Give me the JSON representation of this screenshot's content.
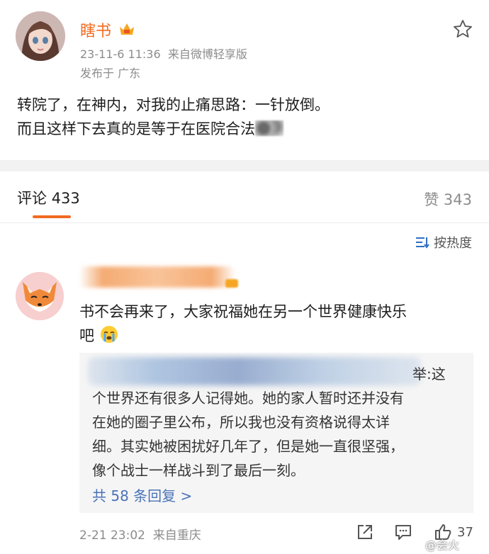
{
  "post": {
    "author": "瞎书",
    "timestamp": "23-11-6 11:36",
    "source": "来自微博轻享版",
    "location": "发布于 广东",
    "text_line1": "转院了，在神内，对我的止痛思路：一针放倒。",
    "text_line2": "而且这样下去真的是等于在医院合法",
    "icons": {
      "vip": "vip-crown-icon",
      "favorite": "star-outline-icon"
    }
  },
  "tabs": {
    "comments_label": "评论",
    "comments_count": "433",
    "likes_label": "赞",
    "likes_count": "343"
  },
  "sort": {
    "label": "按热度"
  },
  "comment": {
    "text_line1": "书不会再来了，大家祝福她在另一个世界健康快乐",
    "text_line2": "吧",
    "reply": {
      "visible_suffix": "举:这",
      "lines": [
        "个世界还有很多人记得她。她的家人暂时还并没有",
        "在她的圈子里公布，所以我也没有资格说得太详",
        "细。其实她被困扰好几年了，但是她一直很坚强，",
        "像个战士一样战斗到了最后一刻。"
      ],
      "more_link": "共 58 条回复 >"
    },
    "time": "2-21 23:02",
    "source": "来自重庆",
    "like_count": "37"
  },
  "watermark": "@会火",
  "colors": {
    "accent": "#f26b21",
    "link": "#4a72b8",
    "muted": "#8c8c8c"
  }
}
